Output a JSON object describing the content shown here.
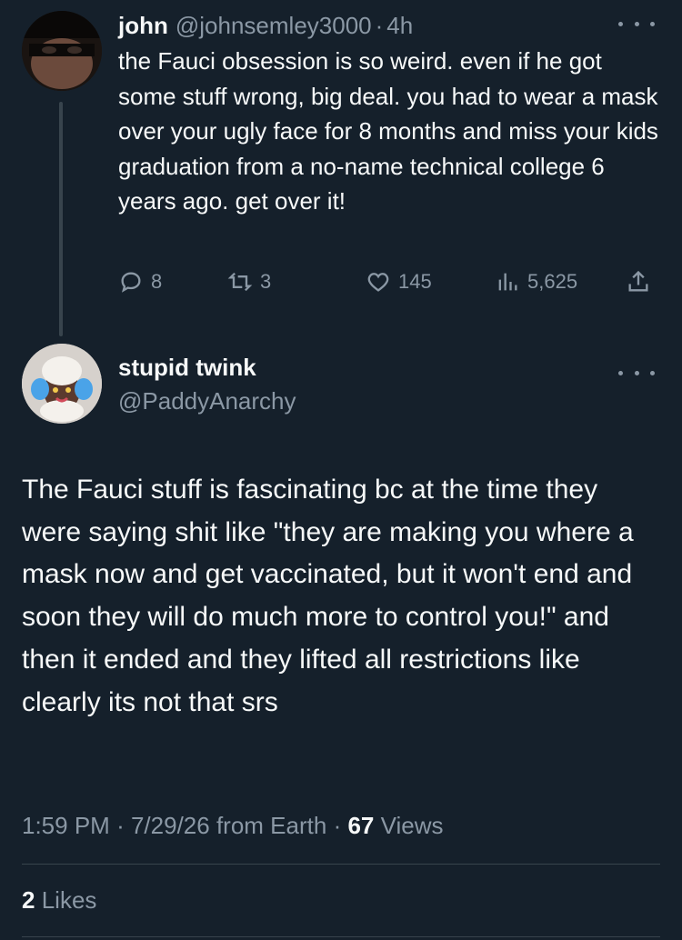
{
  "reply_tweet": {
    "name": "john",
    "handle": "@johnsemley3000",
    "separator": "·",
    "time": "4h",
    "text": "the Fauci obsession is so weird. even if he got some stuff wrong, big deal. you had to wear a mask over your ugly face for 8 months and miss your kids graduation from a no-name technical college 6 years ago. get over it!",
    "actions": {
      "replies": "8",
      "retweets": "3",
      "likes": "145",
      "views": "5,625"
    }
  },
  "main_tweet": {
    "name": "stupid twink",
    "handle": "@PaddyAnarchy",
    "text": "The Fauci stuff is fascinating bc at the time they were saying shit like \"they are making you where a mask now and get vaccinated, but it won't end and soon they will do much more to control you!\" and then it ended and they lifted all restrictions like clearly its not that srs",
    "time": "1:59 PM",
    "separator": "·",
    "date": "7/29/26",
    "source": "from Earth",
    "views_count": "67",
    "views_label": "Views",
    "likes_count": "2",
    "likes_label": "Likes"
  },
  "colors": {
    "background": "#15202b",
    "text_primary": "#f7f9f9",
    "text_secondary": "#8b98a5",
    "divider": "#38444d"
  },
  "icons": [
    "more-options-icon",
    "reply-icon",
    "retweet-icon",
    "like-icon",
    "views-icon",
    "share-icon"
  ]
}
